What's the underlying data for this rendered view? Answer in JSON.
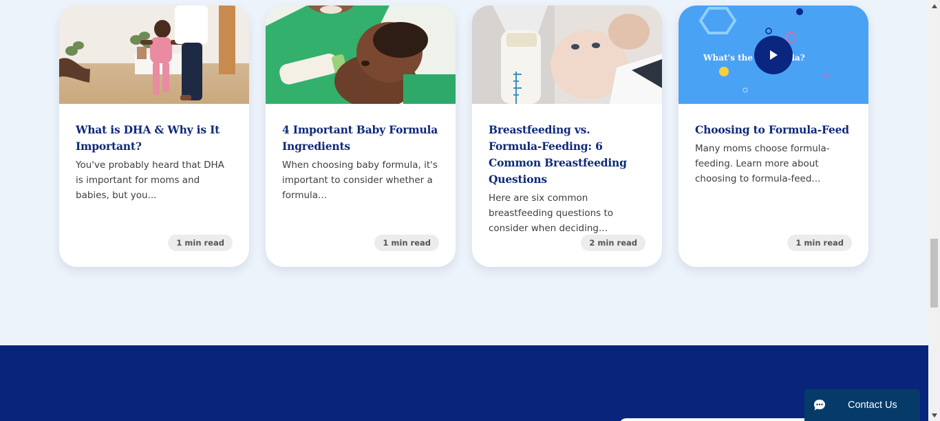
{
  "cards": [
    {
      "title": "What is DHA & Why is It Important?",
      "description": "You've probably heard that DHA is important for moms and babies, but you...",
      "read_time": "1 min read",
      "image": "toddler-walking-photo"
    },
    {
      "title": "4 Important Baby Formula Ingredients",
      "description": "When choosing baby formula, it's important to consider whether a formula...",
      "read_time": "1 min read",
      "image": "baby-bottle-feeding-photo"
    },
    {
      "title": "Breastfeeding vs. Formula-Feeding: 6 Common Breastfeeding Questions",
      "description": "Here are six common breastfeeding questions to consider when deciding...",
      "read_time": "2 min read",
      "image": "breast-pump-baby-photo"
    },
    {
      "title": "Choosing to Formula-Feed",
      "description": "Many moms choose formula-feeding. Learn more about choosing to formula-feed...",
      "read_time": "1 min read",
      "image": "video-thumbnail",
      "video_title": "What's the         y formula?"
    }
  ],
  "contact": {
    "label": "Contact Us",
    "icon": "chat-bubble-icon"
  },
  "colors": {
    "title": "#0e2a7a",
    "footer": "#08257b",
    "contact": "#063b69",
    "video_bg": "#4aa2f5",
    "play_button": "#0a2680"
  }
}
